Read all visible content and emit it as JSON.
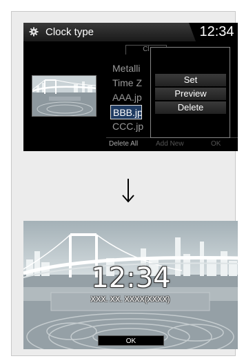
{
  "top_screen": {
    "title": "Clock type",
    "clock": "12:34",
    "tab_partial": "Cl",
    "files": [
      "Metalli",
      "Time Z",
      "AAA.jp",
      "BBB.jp",
      "CCC.jp"
    ],
    "selected_index": 3,
    "bottom": {
      "delete_all": "Delete All",
      "add_new": "Add New",
      "ok": "OK"
    },
    "popup": [
      "Set",
      "Preview",
      "Delete"
    ]
  },
  "bottom_screen": {
    "clock": "12:34",
    "date": "XXX. XX. XXXX(XXXX)",
    "ok": "OK"
  },
  "colors": {
    "highlight": "#1f3b62",
    "background": "#ececec"
  }
}
